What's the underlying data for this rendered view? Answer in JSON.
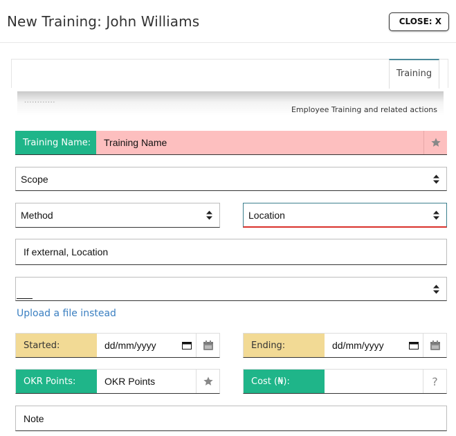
{
  "window": {
    "title": "New Training: John Williams",
    "close_label": "CLOSE: X"
  },
  "tabs": [
    {
      "label": "Training",
      "active": true
    }
  ],
  "banner": {
    "dots": "............",
    "description": "Employee Training and related actions"
  },
  "form": {
    "training_name": {
      "label": "Training Name:",
      "value": "Training Name",
      "icon": "star-icon"
    },
    "scope": {
      "value": "Scope"
    },
    "method": {
      "value": "Method"
    },
    "location": {
      "value": "Location"
    },
    "external_location": {
      "value": "If external, Location"
    },
    "file_select": {
      "value": ""
    },
    "upload_link": "Upload a file instead",
    "started": {
      "label": "Started:",
      "value": "dd/mm/yyyy",
      "icon": "calendar-icon"
    },
    "ending": {
      "label": "Ending:",
      "value": "dd/mm/yyyy",
      "icon": "calendar-icon"
    },
    "okr_points": {
      "label": "OKR Points:",
      "value": "OKR Points",
      "icon": "star-icon"
    },
    "cost": {
      "label": "Cost (₦):",
      "value": "",
      "icon": "question-icon"
    },
    "note": {
      "value": "Note"
    }
  },
  "colors": {
    "green": "#1fb589",
    "yellow": "#f2da95",
    "required_bg": "#fdbfbf",
    "link": "#3a7fc1",
    "error_underline": "#d9302a"
  }
}
